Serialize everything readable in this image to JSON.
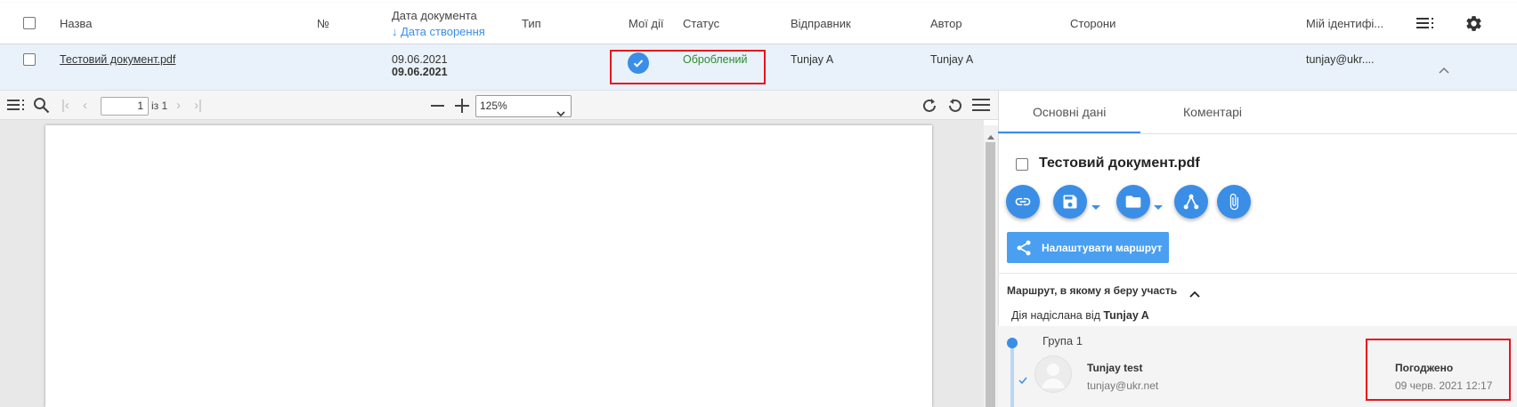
{
  "table": {
    "headers": {
      "name": "Назва",
      "number": "№",
      "doc_date": "Дата документа",
      "created_sort": "↓ Дата створення",
      "type": "Тип",
      "my_actions": "Мої дії",
      "status": "Статус",
      "sender": "Відправник",
      "author": "Автор",
      "parties": "Сторони",
      "my_id": "Мій ідентифі..."
    },
    "row": {
      "name": "Тестовий документ.pdf",
      "doc_date": "09.06.2021",
      "created_date": "09.06.2021",
      "status": "Оброблений",
      "status_color": "#2e8b2e",
      "sender": "Tunjay A",
      "author": "Tunjay A",
      "my_id": "tunjay@ukr...."
    }
  },
  "pdf_toolbar": {
    "page_value": "1",
    "page_of": "із 1",
    "zoom": "125%"
  },
  "panel": {
    "tabs": [
      "Основні дані",
      "Коментарі"
    ],
    "document_title": "Тестовий документ.pdf",
    "route_button": "Налаштувати маршрут",
    "route_section_title": "Маршрут, в якому я беру участь",
    "action_sent_prefix": "Дія надіслана від ",
    "action_sent_by": "Tunjay A",
    "group_name": "Група 1",
    "participant_name": "Tunjay test",
    "participant_email": "tunjay@ukr.net",
    "decision": "Погоджено",
    "decision_date": "09 черв. 2021 12:17"
  },
  "colors": {
    "accent": "#3a8ee6",
    "highlight": "#e8141e",
    "row_selected": "#e9f2fb"
  }
}
